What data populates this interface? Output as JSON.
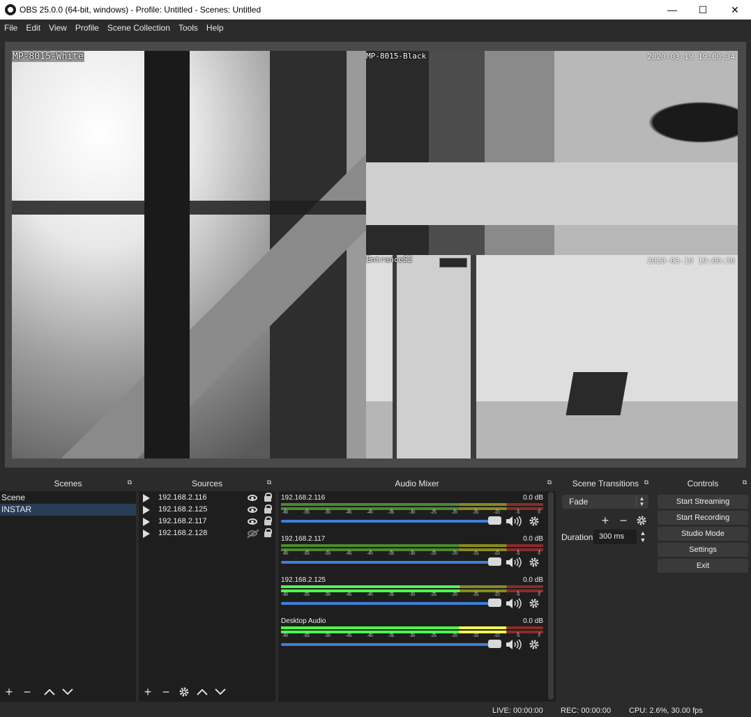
{
  "window": {
    "title": "OBS 25.0.0 (64-bit, windows) - Profile: Untitled - Scenes: Untitled",
    "minimize": "—",
    "maximize": "☐",
    "close": "✕"
  },
  "menu": [
    "File",
    "Edit",
    "View",
    "Profile",
    "Scene Collection",
    "Tools",
    "Help"
  ],
  "preview": {
    "cam1_label": "MP-8015-White",
    "cam2_label": "MP-8015-Black",
    "cam2_timestamp": "2020-03-19 19:00:34",
    "cam3_label": "EntranceS2",
    "cam3_timestamp": "2020-03-19 19:00:30"
  },
  "scenes": {
    "title": "Scenes",
    "items": [
      "Scene",
      "INSTAR"
    ],
    "selected": "INSTAR"
  },
  "sources": {
    "title": "Sources",
    "items": [
      {
        "name": "192.168.2.116",
        "visible": true
      },
      {
        "name": "192.168.2.125",
        "visible": true
      },
      {
        "name": "192.168.2.117",
        "visible": true
      },
      {
        "name": "192.168.2.128",
        "visible": false
      }
    ]
  },
  "mixer": {
    "title": "Audio Mixer",
    "ticks": [
      "-60",
      "-55",
      "-50",
      "-45",
      "-40",
      "-35",
      "-30",
      "-25",
      "-20",
      "-15",
      "-10",
      "-5",
      "0"
    ],
    "channels": [
      {
        "name": "192.168.2.116",
        "db": "0.0 dB",
        "level": 0.0
      },
      {
        "name": "192.168.2.117",
        "db": "0.0 dB",
        "level": 0.0
      },
      {
        "name": "192.168.2.125",
        "db": "0.0 dB",
        "level": 0.68
      },
      {
        "name": "Desktop Audio",
        "db": "0.0 dB",
        "level": 0.86
      }
    ]
  },
  "transitions": {
    "title": "Scene Transitions",
    "selected": "Fade",
    "duration_label": "Duration",
    "duration_value": "300 ms"
  },
  "controls": {
    "title": "Controls",
    "start_streaming": "Start Streaming",
    "start_recording": "Start Recording",
    "studio_mode": "Studio Mode",
    "settings": "Settings",
    "exit": "Exit"
  },
  "status": {
    "live": "LIVE: 00:00:00",
    "rec": "REC: 00:00:00",
    "cpu": "CPU: 2.6%, 30.00 fps"
  },
  "colors": {
    "accent": "#3f7fd9",
    "selected_row": "#273d55",
    "meter_green": "#4cff4c",
    "meter_yellow": "#ffff50",
    "meter_red": "#ff4040"
  }
}
